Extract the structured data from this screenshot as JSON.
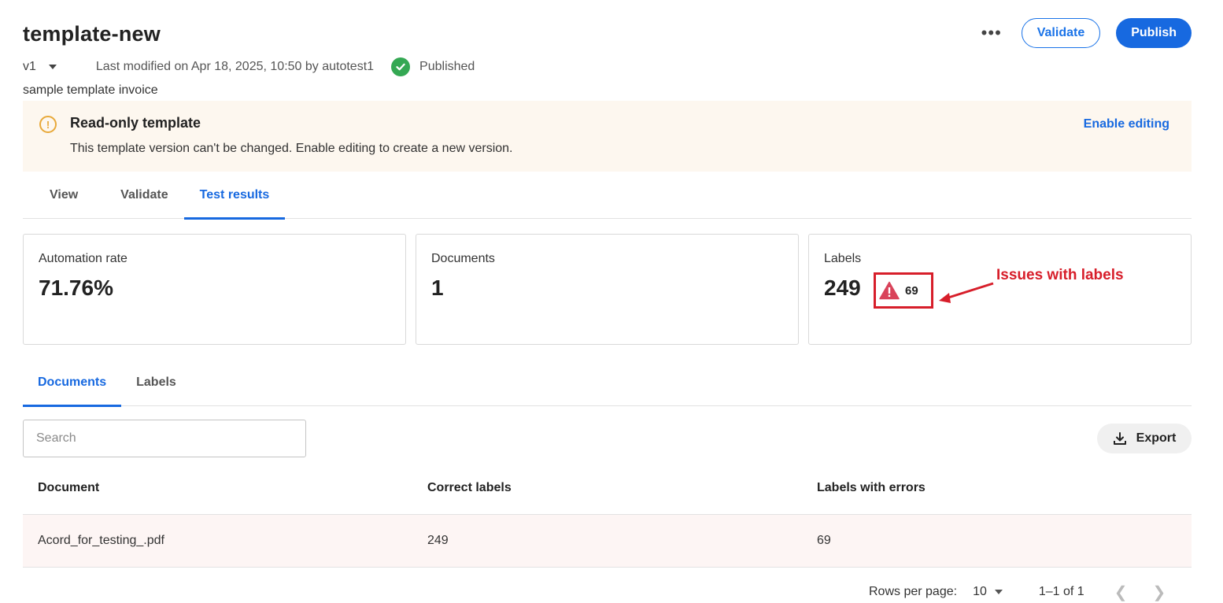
{
  "header": {
    "title": "template-new",
    "more_icon": "more-horizontal-icon",
    "validate_label": "Validate",
    "publish_label": "Publish"
  },
  "meta": {
    "version": "v1",
    "modified": "Last modified on Apr 18, 2025, 10:50 by autotest1",
    "status": "Published",
    "status_color": "#34a853",
    "description": "sample template invoice"
  },
  "banner": {
    "title": "Read-only template",
    "text": "This template version can't be changed. Enable editing to create a new version.",
    "link": "Enable editing",
    "icon": "warning-circle-icon",
    "background": "#fdf7ef"
  },
  "tabs": [
    {
      "label": "View",
      "active": false
    },
    {
      "label": "Validate",
      "active": false
    },
    {
      "label": "Test results",
      "active": true
    }
  ],
  "cards": {
    "automation": {
      "label": "Automation rate",
      "value": "71.76%"
    },
    "documents": {
      "label": "Documents",
      "value": "1"
    },
    "labels": {
      "label": "Labels",
      "value": "249",
      "issues": "69",
      "issues_icon": "warning-triangle-icon"
    }
  },
  "annotation": {
    "text": "Issues with labels",
    "color": "#d71e2a"
  },
  "subtabs": [
    {
      "label": "Documents",
      "active": true
    },
    {
      "label": "Labels",
      "active": false
    }
  ],
  "search": {
    "placeholder": "Search",
    "value": ""
  },
  "export": {
    "label": "Export",
    "icon": "download-icon"
  },
  "table": {
    "headers": [
      "Document",
      "Correct labels",
      "Labels with errors"
    ],
    "rows": [
      [
        "Acord_for_testing_.pdf",
        "249",
        "69"
      ]
    ]
  },
  "pagination": {
    "rows_per_page_label": "Rows per page:",
    "rows_per_page": "10",
    "range": "1–1 of 1",
    "prev_icon": "chevron-left-icon",
    "next_icon": "chevron-right-icon"
  },
  "colors": {
    "accent": "#1769e0",
    "warning": "#e8a93a",
    "error": "#d71e2a"
  }
}
